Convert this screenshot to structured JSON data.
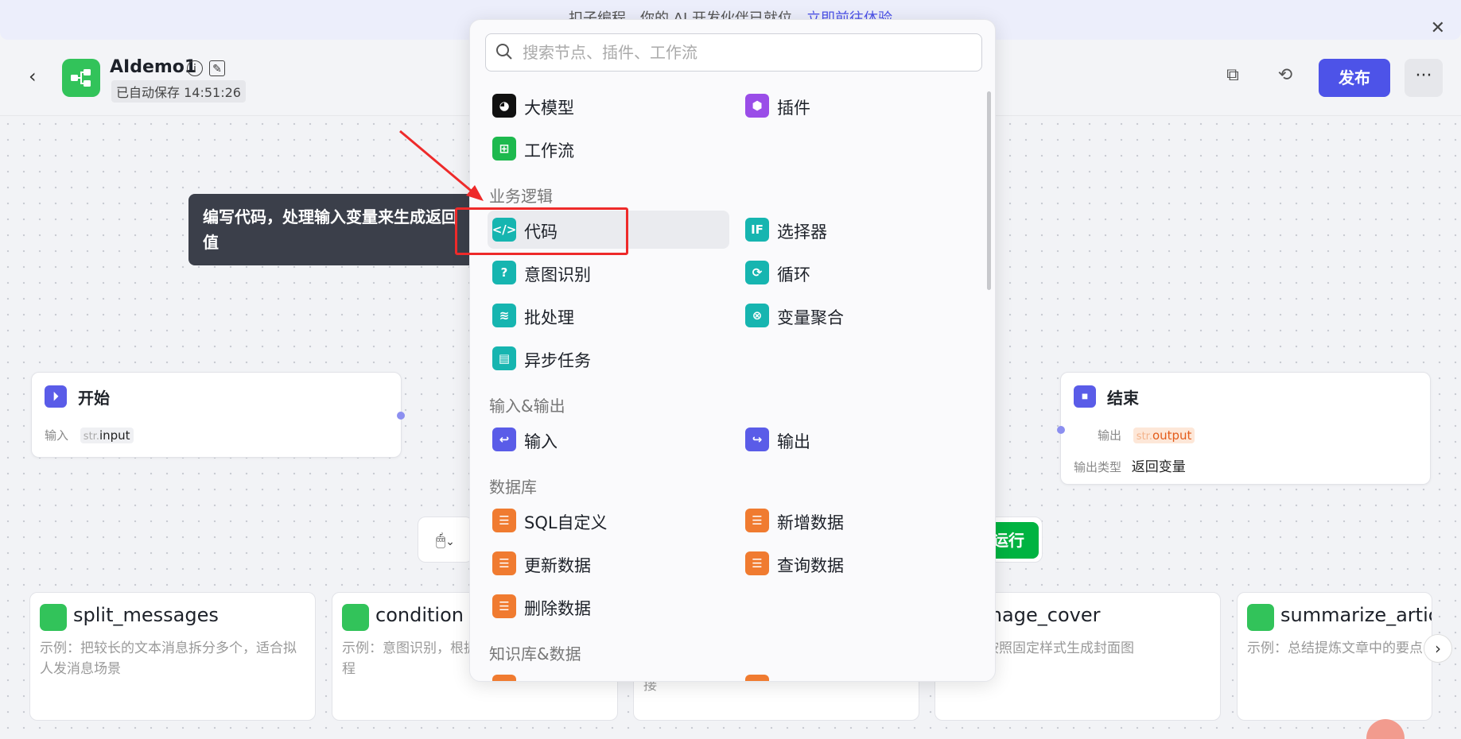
{
  "banner": {
    "text": "扣子编程，你的 AI 开发伙伴已就位，",
    "link": "立即前往体验"
  },
  "header": {
    "title": "AIdemo1",
    "autosave": "已自动保存 14:51:26",
    "publish_label": "发布"
  },
  "nodes": {
    "start": {
      "title": "开始",
      "input_label": "输入",
      "input_type": "str.",
      "input_name": "input"
    },
    "end": {
      "title": "结束",
      "output_label": "输出",
      "output_type": "str.",
      "output_name": "output",
      "output_kind_label": "输出类型",
      "output_kind_value": "返回变量"
    }
  },
  "toolbar": {
    "run_label": "运行"
  },
  "tooltip": {
    "text": "编写代码，处理输入变量来生成返回值"
  },
  "picker": {
    "search_placeholder": "搜索节点、插件、工作流",
    "top_items": [
      {
        "label": "大模型",
        "icon": "llm-icon"
      },
      {
        "label": "插件",
        "icon": "plugin-icon"
      },
      {
        "label": "工作流",
        "icon": "workflow-icon"
      }
    ],
    "sections": [
      {
        "label": "业务逻辑",
        "items": [
          {
            "label": "代码",
            "icon": "code-icon"
          },
          {
            "label": "选择器",
            "icon": "if-icon"
          },
          {
            "label": "意图识别",
            "icon": "intent-icon"
          },
          {
            "label": "循环",
            "icon": "loop-icon"
          },
          {
            "label": "批处理",
            "icon": "batch-icon"
          },
          {
            "label": "变量聚合",
            "icon": "variable-merge-icon"
          },
          {
            "label": "异步任务",
            "icon": "async-task-icon"
          }
        ]
      },
      {
        "label": "输入&输出",
        "items": [
          {
            "label": "输入",
            "icon": "input-icon"
          },
          {
            "label": "输出",
            "icon": "output-icon"
          }
        ]
      },
      {
        "label": "数据库",
        "items": [
          {
            "label": "SQL自定义",
            "icon": "database-sql-icon"
          },
          {
            "label": "新增数据",
            "icon": "database-add-icon"
          },
          {
            "label": "更新数据",
            "icon": "database-update-icon"
          },
          {
            "label": "查询数据",
            "icon": "database-query-icon"
          },
          {
            "label": "删除数据",
            "icon": "database-delete-icon"
          }
        ]
      },
      {
        "label": "知识库&数据",
        "items": []
      }
    ]
  },
  "cards": [
    {
      "title": "split_messages",
      "desc": "示例：把较长的文本消息拆分多个，适合拟人发消息场景"
    },
    {
      "title": "condition",
      "desc": "示例：意图识别，根据不同意图执行不同流程"
    },
    {
      "title": "",
      "desc": "接"
    },
    {
      "title": "image_cover",
      "desc": "示例：按照固定样式生成封面图"
    },
    {
      "title": "summarize_article",
      "desc": "示例：总结提炼文章中的要点"
    }
  ],
  "colors": {
    "accent": "#4d53e8",
    "run_green": "#00b341",
    "highlight_red": "#ee2a2a"
  }
}
